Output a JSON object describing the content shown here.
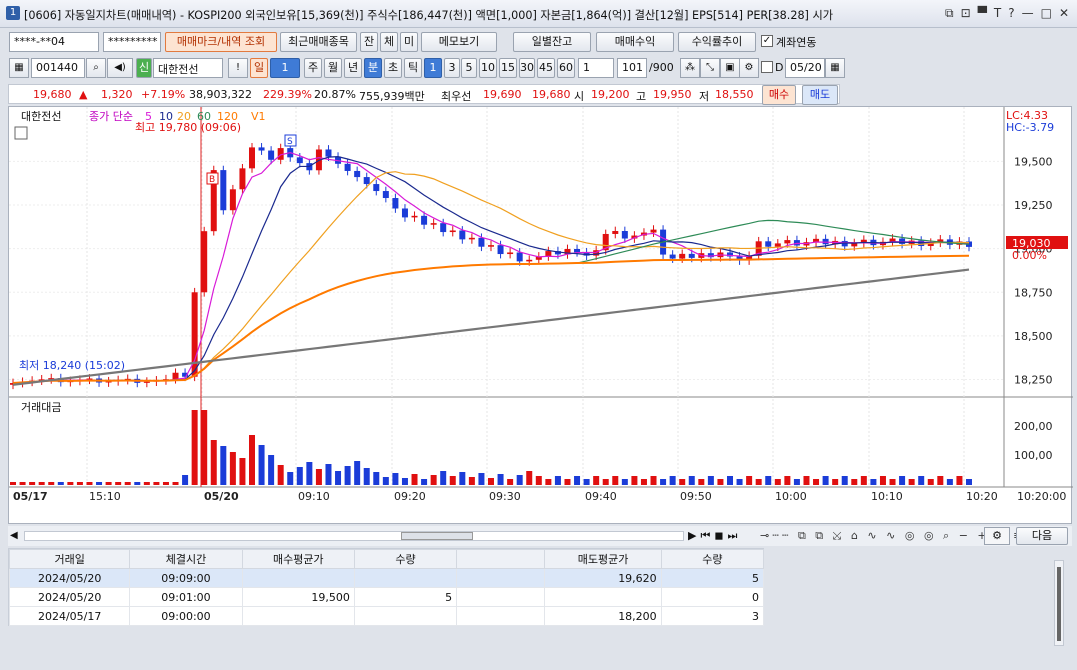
{
  "window": {
    "number": "1",
    "title": "[0606] 자동일지차트(매매내역) - KOSPI200 외국인보유[15,369(천)] 주식수[186,447(천)] 액면[1,000] 자본금[1,864(억)] 결산[12월] EPS[514] PER[38.28] 시가"
  },
  "toolbar1": {
    "account": "****-**04",
    "password": "*********",
    "tab_marks": "매매마크/내역 조회",
    "tab_recent": "최근매매종목",
    "b_jan": "잔",
    "b_che": "체",
    "b_mi": "미",
    "memo": "메모보기",
    "daily": "일별잔고",
    "pnl": "매매수익",
    "returns": "수익률추이",
    "link": "계좌연동"
  },
  "toolbar2": {
    "code": "001440",
    "market": "신",
    "name": "대한전선",
    "excl": "!",
    "period": "일",
    "period_n": "1",
    "week": "주",
    "month": "월",
    "year": "년",
    "minute": "분",
    "sec": "초",
    "tick": "틱",
    "intervals": [
      "1",
      "3",
      "5",
      "10",
      "15",
      "30",
      "45",
      "60"
    ],
    "interval_sel": "1",
    "count": "101",
    "count_total": "/900",
    "d_label": "D",
    "date": "05/20"
  },
  "quote": {
    "price": "19,680",
    "arrow": "▲",
    "change": "1,320",
    "rate": "+7.19%",
    "volume": "38,903,322",
    "vol_rate": "229.39%",
    "turnover": "20.87%",
    "amount": "755,939백만",
    "best_label": "최우선",
    "ask": "19,690",
    "bid": "19,680",
    "open_label": "시",
    "open": "19,200",
    "high_label": "고",
    "high": "19,950",
    "low_label": "저",
    "low": "18,550",
    "buy": "매수",
    "sell": "매도"
  },
  "chart_data": {
    "type": "candlestick",
    "legend": {
      "name": "대한전선",
      "ma_label": "종가 단순",
      "ma": [
        "5",
        "10",
        "20",
        "60",
        "120"
      ],
      "vol_label": "V1"
    },
    "annotations": {
      "high": "최고 19,780 (09:06)",
      "low": "최저 18,240 (15:02)",
      "lc": "LC:4.33",
      "hc": "HC:-3.79",
      "current": "19,030",
      "current_pct": "0.00%",
      "buy_mark": "B",
      "sell_mark": "S"
    },
    "y_ticks": [
      "19,500",
      "19,250",
      "19,000",
      "18,750",
      "18,500",
      "18,250"
    ],
    "ylim": [
      18150,
      19800
    ],
    "vol_label": "거래대금",
    "vol_ticks": [
      "200,00",
      "100,00"
    ],
    "x_ticks": [
      "05/17",
      "15:10",
      "05/20",
      "09:10",
      "09:20",
      "09:30",
      "09:40",
      "09:50",
      "10:00",
      "10:10",
      "10:20",
      "10:20:00"
    ]
  },
  "bottom_tools": {
    "next": "다음"
  },
  "grid": {
    "headers": [
      "거래일",
      "체결시간",
      "매수평균가",
      "수량",
      "",
      "매도평균가",
      "수량"
    ],
    "rows": [
      [
        "2024/05/20",
        "09:09:00",
        "",
        "",
        "",
        "19,620",
        "5"
      ],
      [
        "2024/05/20",
        "09:01:00",
        "19,500",
        "5",
        "",
        "",
        "0"
      ],
      [
        "2024/05/17",
        "09:00:00",
        "",
        "",
        "",
        "18,200",
        "3"
      ]
    ]
  }
}
